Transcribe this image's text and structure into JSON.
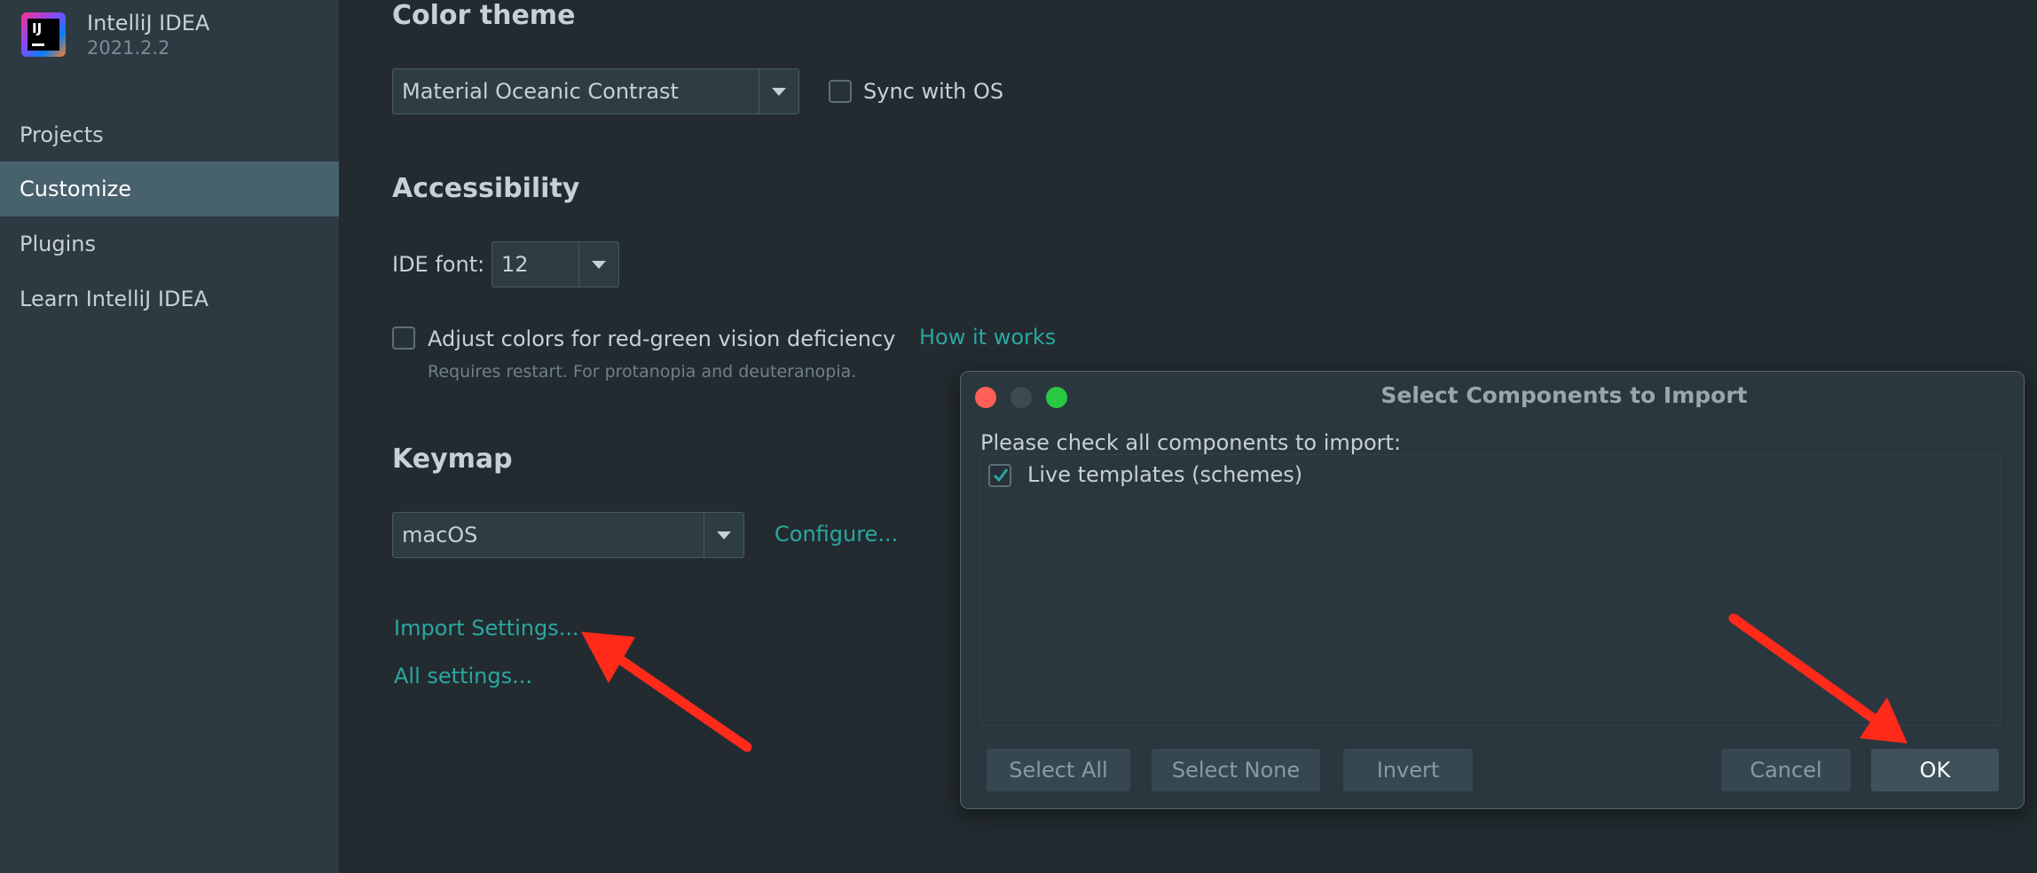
{
  "app": {
    "name": "IntelliJ IDEA",
    "version": "2021.2.2",
    "logo_text": "IJ"
  },
  "sidebar": {
    "items": [
      {
        "label": "Projects",
        "active": false
      },
      {
        "label": "Customize",
        "active": true
      },
      {
        "label": "Plugins",
        "active": false
      },
      {
        "label": "Learn IntelliJ IDEA",
        "active": false
      }
    ]
  },
  "color_theme": {
    "title": "Color theme",
    "selected": "Material Oceanic Contrast",
    "sync_label": "Sync with OS",
    "sync_checked": false
  },
  "accessibility": {
    "title": "Accessibility",
    "ide_font_label": "IDE font:",
    "ide_font_value": "12",
    "adjust_colors_label": "Adjust colors for red-green vision deficiency",
    "adjust_colors_checked": false,
    "how_it_works": "How it works",
    "hint": "Requires restart. For protanopia and deuteranopia."
  },
  "keymap": {
    "title": "Keymap",
    "selected": "macOS",
    "configure": "Configure..."
  },
  "links": {
    "import_settings": "Import Settings...",
    "all_settings": "All settings..."
  },
  "dialog": {
    "title": "Select Components to Import",
    "instruction": "Please check all components to import:",
    "items": [
      {
        "label": "Live templates (schemes)",
        "checked": true
      }
    ],
    "buttons": {
      "select_all": "Select All",
      "select_none": "Select None",
      "invert": "Invert",
      "cancel": "Cancel",
      "ok": "OK"
    }
  },
  "colors": {
    "background": "#232b30",
    "sidebar": "#2d3a42",
    "sidebar_active": "#47616d",
    "link": "#2aa7a0",
    "annotation_arrow": "#ff2a1a",
    "traffic_close": "#fe5f57",
    "traffic_min": "#3d4a51",
    "traffic_max": "#28c840"
  }
}
